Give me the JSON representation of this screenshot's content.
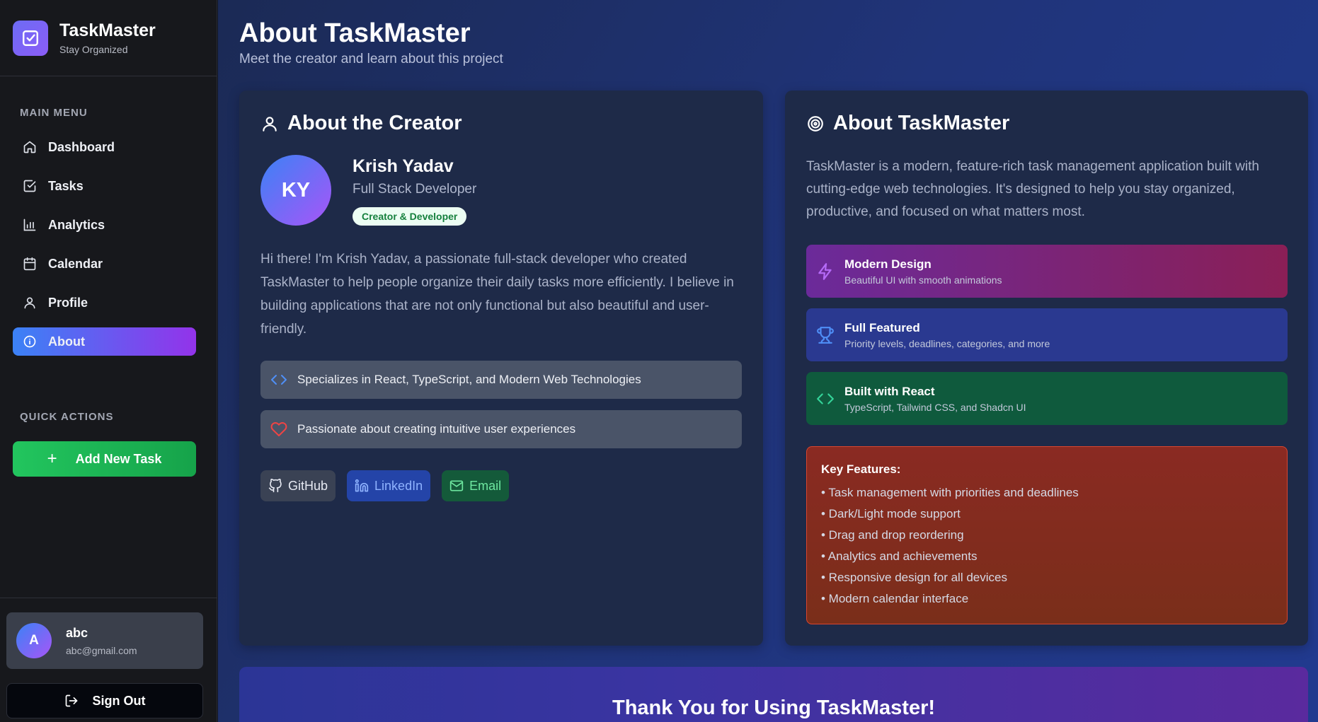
{
  "brand": {
    "title": "TaskMaster",
    "subtitle": "Stay Organized"
  },
  "sidebar": {
    "main_menu_label": "MAIN MENU",
    "items": [
      {
        "label": "Dashboard",
        "icon": "home-icon"
      },
      {
        "label": "Tasks",
        "icon": "check-square-icon"
      },
      {
        "label": "Analytics",
        "icon": "bar-chart-icon"
      },
      {
        "label": "Calendar",
        "icon": "calendar-icon"
      },
      {
        "label": "Profile",
        "icon": "user-icon"
      },
      {
        "label": "About",
        "icon": "info-icon",
        "active": true
      }
    ],
    "quick_actions_label": "QUICK ACTIONS",
    "add_task_label": "Add New Task",
    "user": {
      "initial": "A",
      "name": "abc",
      "email": "abc@gmail.com"
    },
    "sign_out_label": "Sign Out"
  },
  "header": {
    "title": "About TaskMaster",
    "subtitle": "Meet the creator and learn about this project"
  },
  "creator_card": {
    "title": "About the Creator",
    "initials": "KY",
    "name": "Krish Yadav",
    "role": "Full Stack Developer",
    "badge": "Creator & Developer",
    "bio": "Hi there! I'm Krish Yadav, a passionate full-stack developer who created TaskMaster to help people organize their daily tasks more efficiently. I believe in building applications that are not only functional but also beautiful and user-friendly.",
    "highlights": [
      "Specializes in React, TypeScript, and Modern Web Technologies",
      "Passionate about creating intuitive user experiences"
    ],
    "links": {
      "github": "GitHub",
      "linkedin": "LinkedIn",
      "email": "Email"
    }
  },
  "about_card": {
    "title": "About TaskMaster",
    "description": "TaskMaster is a modern, feature-rich task management application built with cutting-edge web technologies. It's designed to help you stay organized, productive, and focused on what matters most.",
    "features": [
      {
        "title": "Modern Design",
        "desc": "Beautiful UI with smooth animations",
        "icon": "lightning-icon"
      },
      {
        "title": "Full Featured",
        "desc": "Priority levels, deadlines, categories, and more",
        "icon": "trophy-icon"
      },
      {
        "title": "Built with React",
        "desc": "TypeScript, Tailwind CSS, and Shadcn UI",
        "icon": "code-icon"
      }
    ],
    "key_features_title": "Key Features:",
    "key_features": [
      "• Task management with priorities and deadlines",
      "• Dark/Light mode support",
      "• Drag and drop reordering",
      "• Analytics and achievements",
      "• Responsive design for all devices",
      "• Modern calendar interface"
    ]
  },
  "footer_banner": {
    "title": "Thank You for Using TaskMaster!"
  }
}
